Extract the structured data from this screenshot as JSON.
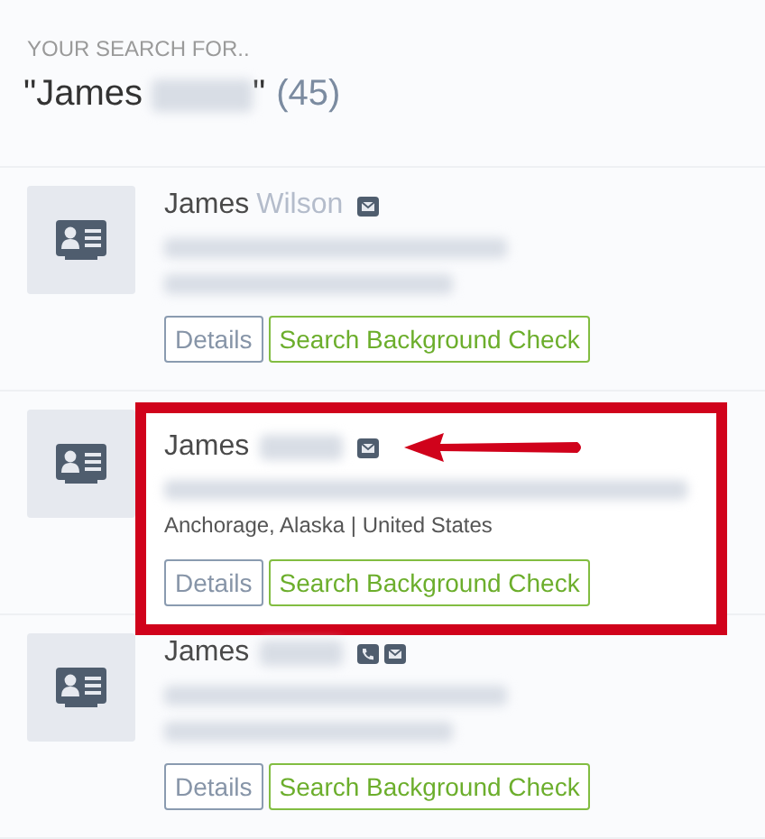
{
  "heading": "YOUR SEARCH FOR..",
  "query": {
    "prefix": "\"James",
    "redacted": true,
    "suffix": "\"",
    "count": "(45)"
  },
  "results": [
    {
      "first_name": "James",
      "surname": "Wilson",
      "surname_redacted": false,
      "phone": false,
      "email": true,
      "title_redacted": true,
      "location_redacted": true,
      "highlighted": false,
      "buttons": [
        "Details",
        "Search Background Check"
      ]
    },
    {
      "first_name": "James",
      "surname_redacted": true,
      "phone": false,
      "email": true,
      "title_redacted": true,
      "location": "Anchorage, Alaska | United States",
      "location_redacted": false,
      "highlighted": true,
      "buttons": [
        "Details",
        "Search Background Check"
      ]
    },
    {
      "first_name": "James",
      "surname_redacted": true,
      "phone": true,
      "email": true,
      "title_redacted": true,
      "location_redacted": true,
      "highlighted": false,
      "buttons": [
        "Details",
        "Search Background Check"
      ]
    }
  ]
}
